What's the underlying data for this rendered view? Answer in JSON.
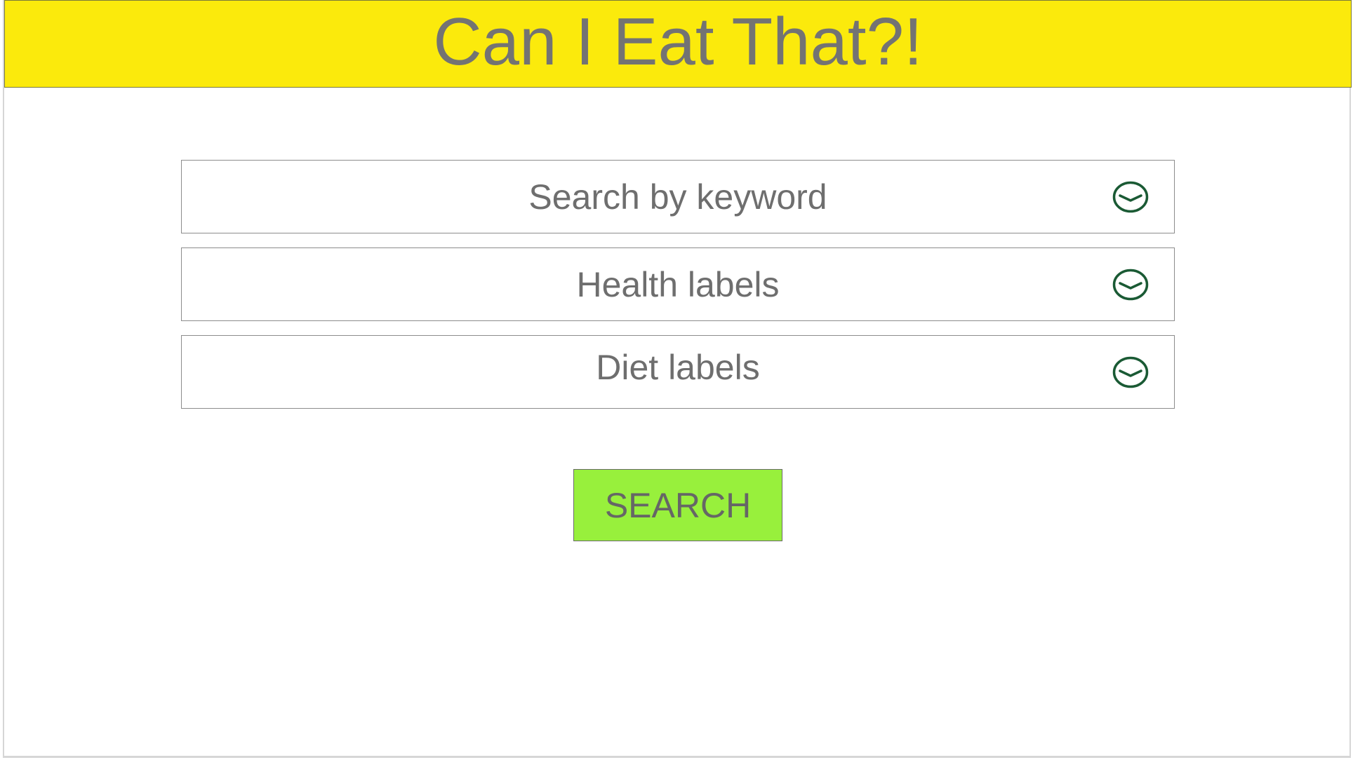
{
  "app": {
    "title": "Can I Eat That?!"
  },
  "form": {
    "fields": [
      {
        "label": "Search by keyword",
        "icon": "chevron-down-circle-icon"
      },
      {
        "label": "Health labels",
        "icon": "chevron-down-circle-icon"
      },
      {
        "label": "Diet labels",
        "icon": "chevron-down-circle-icon"
      }
    ],
    "search_label": "SEARCH"
  },
  "colors": {
    "header_bg": "#fbea0c",
    "button_bg": "#98f03c",
    "icon": "#1a5a34",
    "text": "#6e6e6e"
  }
}
